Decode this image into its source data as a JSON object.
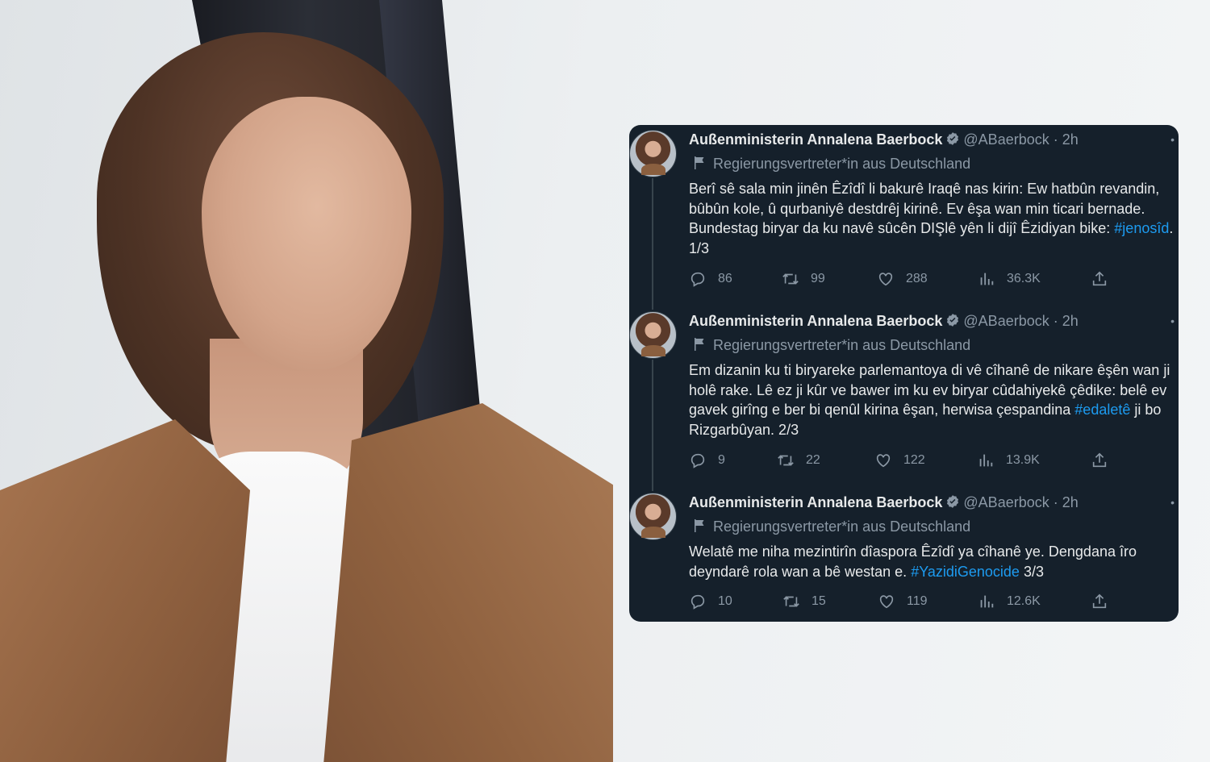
{
  "tweets": [
    {
      "name": "Außenministerin Annalena Baerbock",
      "handle": "@ABaerbock",
      "separator": "·",
      "time": "2h",
      "label": "Regierungsvertreter*in aus Deutschland",
      "text_before": "Berî sê sala min jinên Êzîdî li bakurê Iraqê nas kirin: Ew hatbûn revandin, bûbûn kole, û qurbaniyê destdrêj kirinê. Ev êşa wan min ticari bernade. Bundestag biryar da ku navê sûcên DIŞlê yên li dijî Êzidiyan bike: ",
      "hashtag": "#jenosîd",
      "text_after": ". 1/3",
      "replies": "86",
      "retweets": "99",
      "likes": "288",
      "views": "36.3K",
      "thread_line": true
    },
    {
      "name": "Außenministerin Annalena Baerbock",
      "handle": "@ABaerbock",
      "separator": "·",
      "time": "2h",
      "label": "Regierungsvertreter*in aus Deutschland",
      "text_before": "Em dizanin ku ti biryareke parlemantoya di vê cîhanê de nikare êşên wan ji holê rake. Lê ez ji kûr ve bawer im ku ev biryar cûdahiyekê çêdike: belê ev gavek girîng e ber bi qenûl kirina êşan, herwisa çespandina ",
      "hashtag": "#edaletê",
      "text_after": " ji bo Rizgarbûyan. 2/3",
      "replies": "9",
      "retweets": "22",
      "likes": "122",
      "views": "13.9K",
      "thread_line": true
    },
    {
      "name": "Außenministerin Annalena Baerbock",
      "handle": "@ABaerbock",
      "separator": "·",
      "time": "2h",
      "label": "Regierungsvertreter*in aus Deutschland",
      "text_before": "Welatê me niha mezintirîn dîaspora Êzîdî ya cîhanê ye. Dengdana îro deyndarê rola wan a bê westan e. ",
      "hashtag": "#YazidiGenocide",
      "text_after": " 3/3",
      "replies": "10",
      "retweets": "15",
      "likes": "119",
      "views": "12.6K",
      "thread_line": false
    }
  ],
  "icons": {
    "reply": "reply-icon",
    "retweet": "retweet-icon",
    "like": "heart-icon",
    "views": "views-icon",
    "share": "share-icon",
    "verified": "verified-badge-icon",
    "label": "government-flag-icon",
    "more": "more-icon"
  },
  "colors": {
    "card_bg": "#15202b",
    "text": "#e7e9ea",
    "secondary": "#8b98a5",
    "link": "#1d9bf0"
  }
}
